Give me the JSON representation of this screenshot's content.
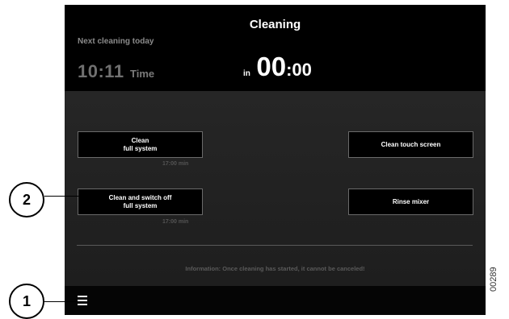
{
  "header": {
    "title": "Cleaning",
    "next_cleaning_label": "Next cleaning today",
    "time_value": "10:11",
    "time_label": "Time",
    "in_label": "in",
    "countdown_big": "00",
    "countdown_small": ":00"
  },
  "buttons": {
    "clean_full_line1": "Clean",
    "clean_full_line2": "full system",
    "clean_full_duration": "17:00 min",
    "clean_switch_off_line1": "Clean and switch off",
    "clean_switch_off_line2": "full system",
    "clean_switch_off_duration": "17:00 min",
    "clean_touch_screen": "Clean touch screen",
    "rinse_mixer": "Rinse mixer"
  },
  "info_text": "Information: Once cleaning has started, it cannot be canceled!",
  "footer": {
    "menu_icon": "menu-icon"
  },
  "callouts": {
    "one": "1",
    "two": "2"
  },
  "figure_id": "00289"
}
